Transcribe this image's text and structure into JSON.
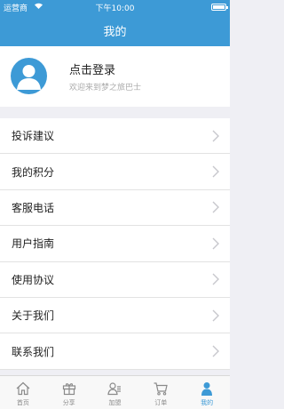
{
  "statusbar": {
    "carrier": "运营商",
    "time": "下午10:00"
  },
  "navbar": {
    "title": "我的"
  },
  "profile": {
    "title": "点击登录",
    "subtitle": "欢迎来到梦之旅巴士"
  },
  "menu": [
    {
      "label": "投诉建议"
    },
    {
      "label": "我的积分"
    },
    {
      "label": "客服电话"
    },
    {
      "label": "用户指南"
    },
    {
      "label": "使用协议"
    },
    {
      "label": "关于我们"
    },
    {
      "label": "联系我们"
    }
  ],
  "tabs": [
    {
      "label": "首页",
      "icon": "home-icon"
    },
    {
      "label": "分享",
      "icon": "gift-icon"
    },
    {
      "label": "加盟",
      "icon": "user-join-icon"
    },
    {
      "label": "订单",
      "icon": "cart-icon"
    },
    {
      "label": "我的",
      "icon": "person-icon",
      "active": true
    }
  ],
  "colors": {
    "accent": "#3d9ad6",
    "background": "#efeff4",
    "inactive": "#8a8a8a"
  }
}
